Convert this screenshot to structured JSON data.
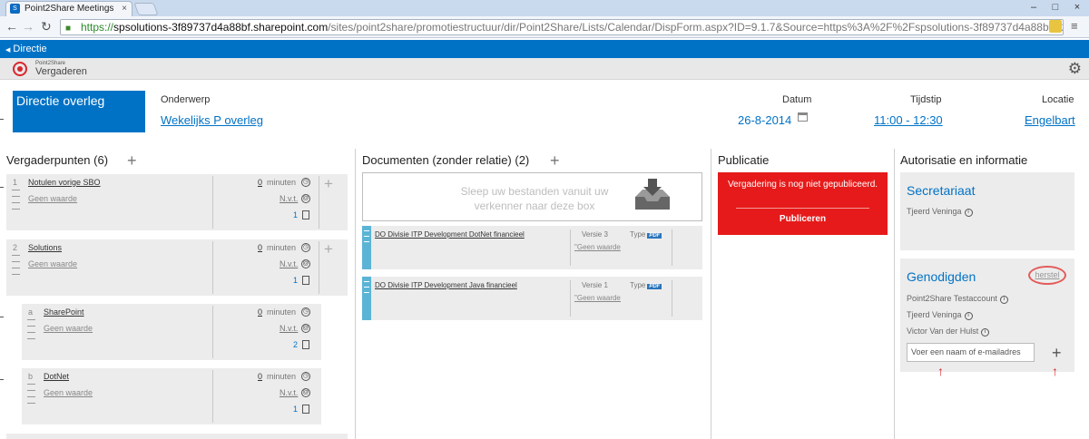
{
  "browser": {
    "tab_title": "Point2Share Meetings",
    "tab_favicon": "S",
    "url_https": "https://",
    "url_host": "spsolutions-3f89737d4a88bf.sharepoint.com",
    "url_path": "/sites/point2share/promotiestructuur/dir/Point2Share/Lists/Calendar/DispForm.aspx?ID=9.1.7&Source=https%3A%2F%2Fspsolutions-3f89737d4a88bf%2Esha"
  },
  "suite": {
    "breadcrumb": "Directie"
  },
  "app": {
    "brand_small": "Point2Share",
    "brand": "Vergaderen"
  },
  "meeting": {
    "title": "Directie overleg",
    "subject_label": "Onderwerp",
    "subject": "Wekelijks P overleg",
    "date_label": "Datum",
    "date": "26-8-2014",
    "time_label": "Tijdstip",
    "time": "11:00 - 12:30",
    "location_label": "Locatie",
    "location": "Engelbart"
  },
  "agenda": {
    "heading": "Vergaderpunten (6)",
    "items": [
      {
        "num": "1",
        "title": "Notulen vorige SBO",
        "desc": "Geen waarde",
        "minutes": "0",
        "minutes_label": "minuten",
        "presenter": "N.v.t.",
        "docs": "1"
      },
      {
        "num": "2",
        "title": "Solutions",
        "desc": "Geen waarde",
        "minutes": "0",
        "minutes_label": "minuten",
        "presenter": "N.v.t.",
        "docs": "1"
      },
      {
        "num": "a",
        "title": "SharePoint",
        "desc": "Geen waarde",
        "minutes": "0",
        "minutes_label": "minuten",
        "presenter": "N.v.t.",
        "docs": "2"
      },
      {
        "num": "b",
        "title": "DotNet",
        "desc": "Geen waarde",
        "minutes": "0",
        "minutes_label": "minuten",
        "presenter": "N.v.t.",
        "docs": "1"
      }
    ]
  },
  "documents": {
    "heading": "Documenten (zonder relatie) (2)",
    "dropzone": "Sleep uw bestanden vanuit uw verkenner naar deze box",
    "items": [
      {
        "title": "DO Divisie ITP Development DotNet financieel",
        "version": "Versie 3",
        "type_label": "Type",
        "type": "PDF",
        "desc": "Geen waarde"
      },
      {
        "title": "DO Divisie ITP Development Java financieel",
        "version": "Versie 1",
        "type_label": "Type",
        "type": "PDF",
        "desc": "Geen waarde"
      }
    ]
  },
  "publication": {
    "heading": "Publicatie",
    "message": "Vergadering is nog niet gepubliceerd.",
    "button": "Publiceren"
  },
  "info": {
    "heading": "Autorisatie en informatie",
    "secretariat_title": "Secretariaat",
    "secretariat_person": "Tjeerd Veninga",
    "invitees_title": "Genodigden",
    "reset": "herstel",
    "invitees": [
      "Point2Share Testaccount",
      "Tjeerd Veninga",
      "Victor Van der Hulst"
    ],
    "input_placeholder": "Voer een naam of e-mailadres"
  },
  "colors": {
    "brand_blue": "#0072c6",
    "alert_red": "#e61a1a",
    "doc_bar": "#5bb4d6"
  }
}
